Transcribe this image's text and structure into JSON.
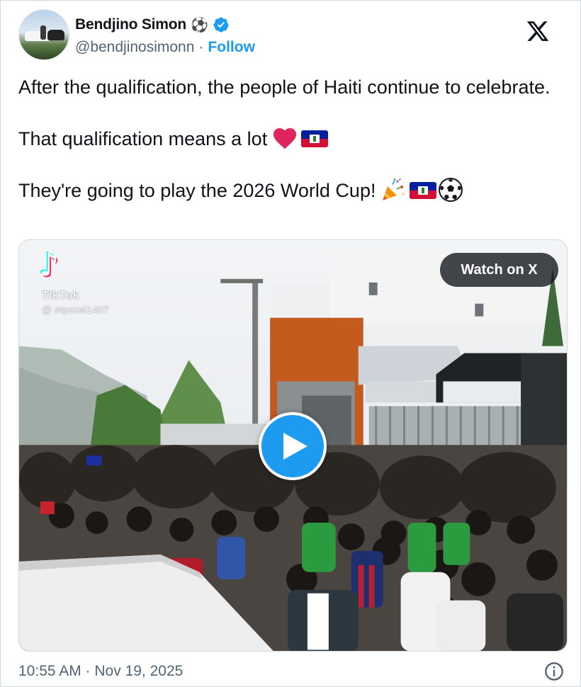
{
  "author": {
    "display_name": "Bendjino Simon",
    "name_emoji": "⚽",
    "handle": "@bendjinosimonn",
    "separator": "·",
    "follow_label": "Follow"
  },
  "tweet": {
    "line1": "After the qualification, the people of Haiti continue to celebrate.",
    "line2": "That qualification means a lot",
    "line3": "They're going to play the 2026 World Cup!"
  },
  "media": {
    "watermark_app": "TikTok",
    "watermark_user": "@ mpocal1407",
    "watch_label": "Watch on X"
  },
  "footer": {
    "timestamp": "10:55 AM · Nov 19, 2025"
  },
  "colors": {
    "accent": "#1d9bf0",
    "text": "#0f1419",
    "secondary": "#536471",
    "border": "#cfd9de",
    "heart": "#e0245e"
  },
  "icons": [
    "verified-badge-icon",
    "x-logo-icon",
    "heart-icon",
    "haiti-flag-icon",
    "party-popper-icon",
    "soccer-ball-icon",
    "play-icon",
    "info-icon"
  ]
}
